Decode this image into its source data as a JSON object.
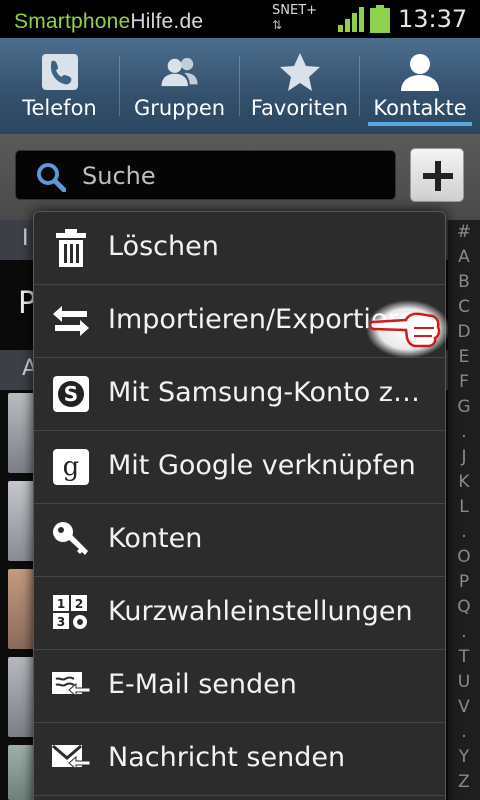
{
  "status_bar": {
    "brand_part1": "Smartphone",
    "brand_part2": "Hilfe.de",
    "carrier": "SNET+",
    "data_arrows": "⇅",
    "time": "13:37"
  },
  "tabs": [
    {
      "label": "Telefon",
      "icon": "phone-icon",
      "active": false
    },
    {
      "label": "Gruppen",
      "icon": "group-icon",
      "active": false
    },
    {
      "label": "Favoriten",
      "icon": "star-icon",
      "active": false
    },
    {
      "label": "Kontakte",
      "icon": "contact-icon",
      "active": true
    }
  ],
  "search": {
    "placeholder": "Suche",
    "add_symbol": "+"
  },
  "background_list": {
    "section1_letter": "I",
    "profile_letter": "P",
    "section2_letter": "A"
  },
  "alpha_index": [
    "#",
    "A",
    "B",
    "C",
    "D",
    "E",
    "F",
    "G",
    ".",
    "J",
    "K",
    "L",
    ".",
    "O",
    "P",
    "Q",
    ".",
    "T",
    "U",
    "V",
    ".",
    "Y",
    "Z"
  ],
  "menu": {
    "items": [
      {
        "label": "Löschen",
        "icon": "trash-icon"
      },
      {
        "label": "Importieren/Exportieren",
        "icon": "import-export-icon"
      },
      {
        "label": "Mit Samsung-Konto z…",
        "icon": "samsung-account-icon"
      },
      {
        "label": "Mit Google verknüpfen",
        "icon": "google-icon"
      },
      {
        "label": "Konten",
        "icon": "key-icon"
      },
      {
        "label": "Kurzwahleinstellungen",
        "icon": "speed-dial-icon"
      },
      {
        "label": "E-Mail senden",
        "icon": "email-icon"
      },
      {
        "label": "Nachricht senden",
        "icon": "message-icon"
      }
    ]
  },
  "colors": {
    "brand_green": "#8fd14f",
    "tab_indicator": "#59a6e0",
    "menu_bg": "#2c2c2c"
  }
}
